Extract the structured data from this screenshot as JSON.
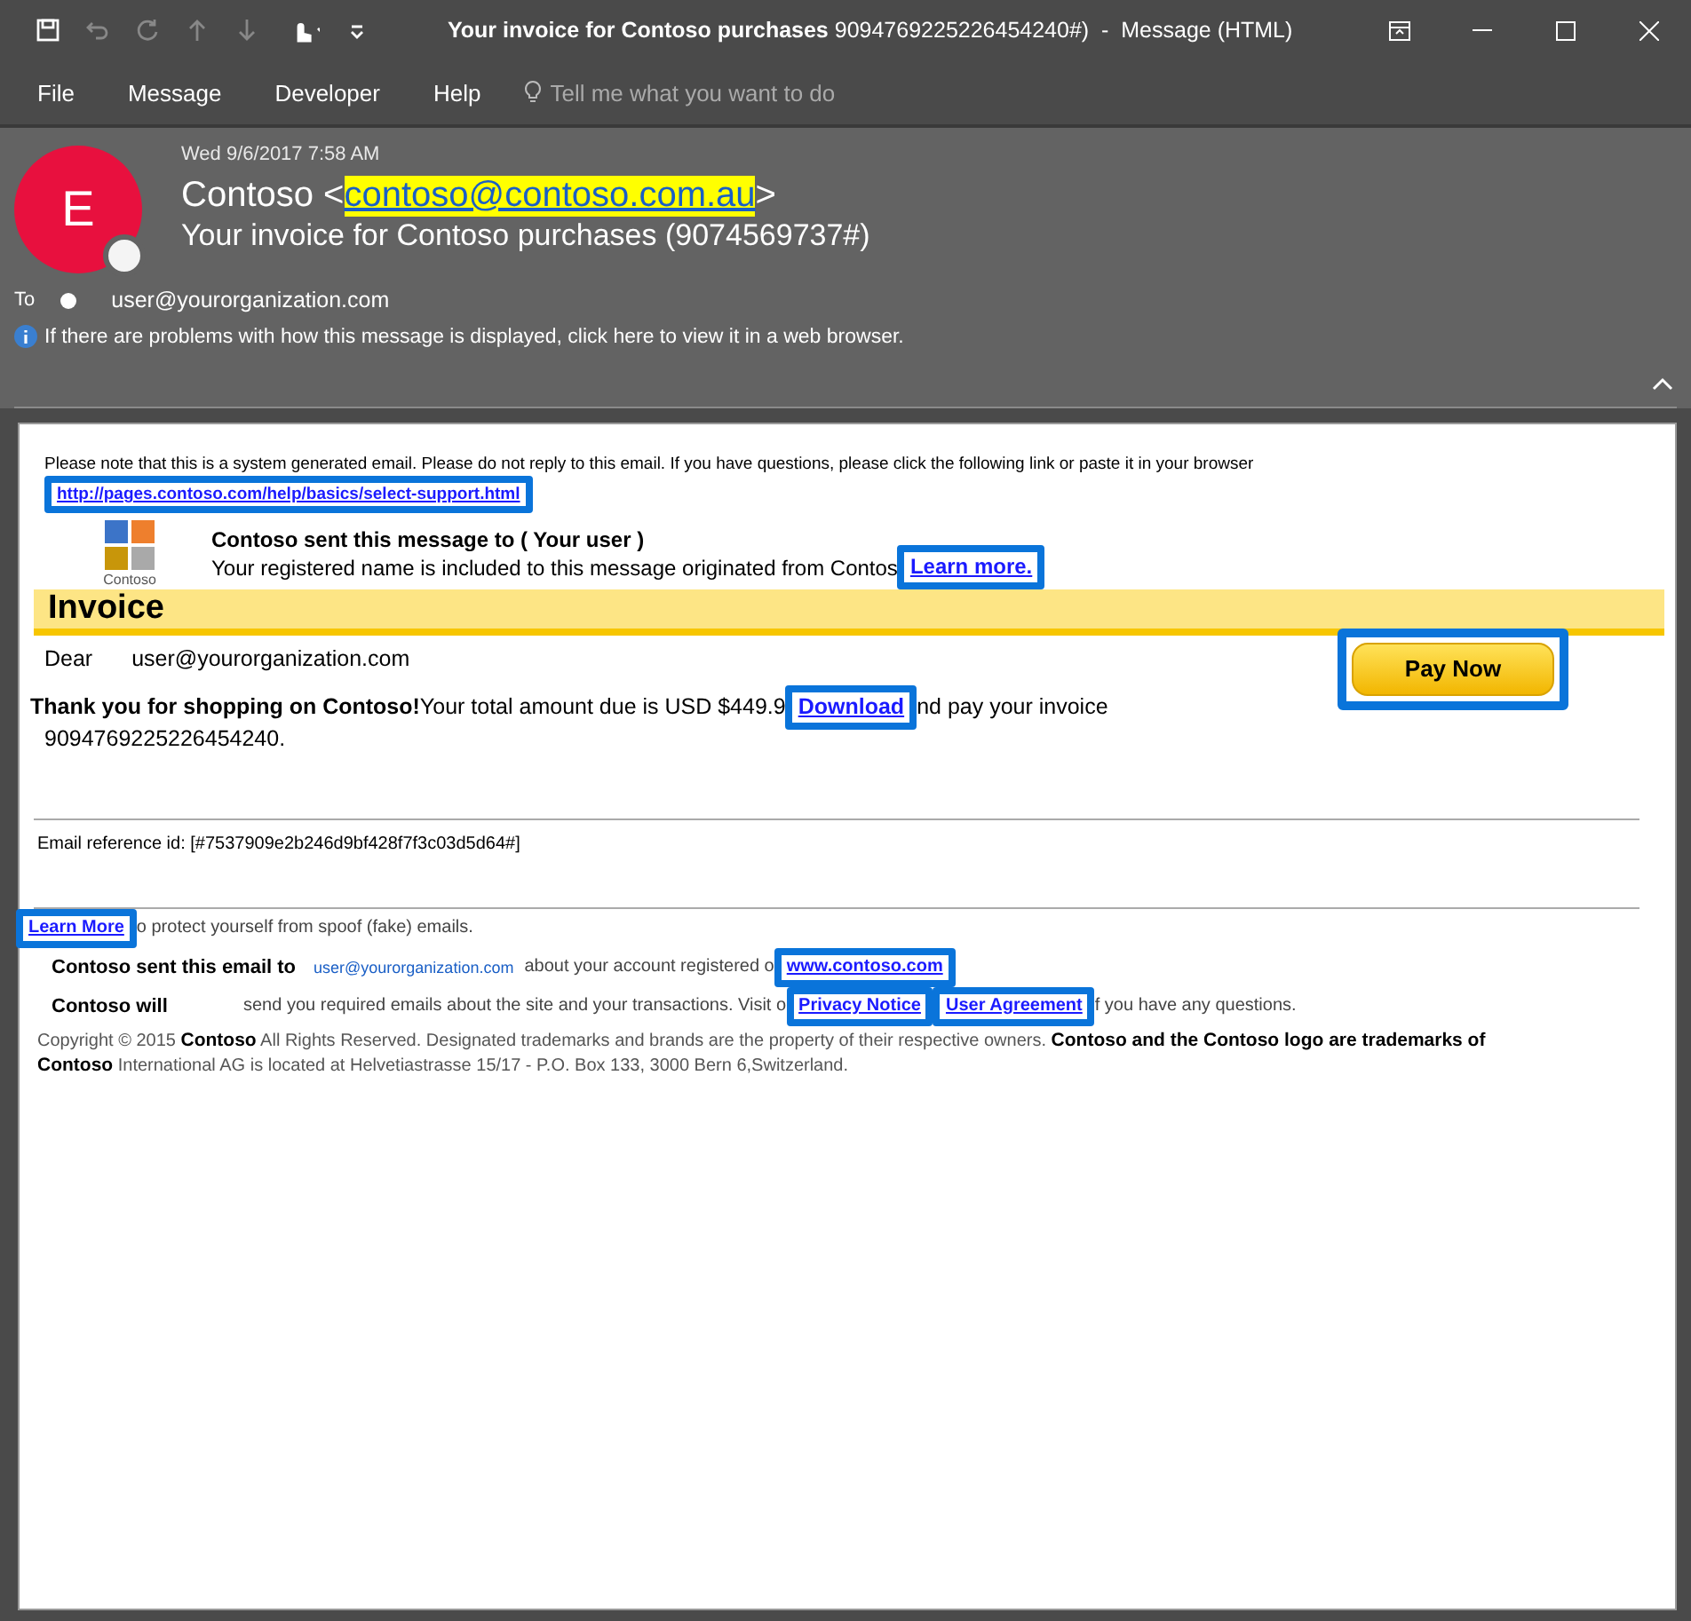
{
  "title_bar": {
    "title_bold": "Your invoice for Contoso purchases",
    "title_rest": "9094769225226454240#)  -  Message (HTML)"
  },
  "menu": [
    {
      "label": "File"
    },
    {
      "label": "Message"
    },
    {
      "label": "Developer"
    },
    {
      "label": "Help"
    }
  ],
  "tell_me": {
    "placeholder": "Tell me what you want to do"
  },
  "header": {
    "avatar_letter": "E",
    "date": "Wed 9/6/2017 7:58 AM",
    "sender_name": "Contoso <",
    "sender_email": "contoso@contoso.com.au",
    "sender_close": ">",
    "subject": "Your invoice for Contoso purchases (9074569737#)",
    "to_label": "To",
    "recipient": "user@yourorganization.com",
    "info": "If there are problems with how this message is displayed, click here to view it in a web browser."
  },
  "body": {
    "notice": {
      "text": "Please note that this is a system generated email. Please do not reply to this email. If you have questions, please click the following link or paste it in your browser",
      "link": "http://pages.contoso.com/help/basics/select-support.html",
      "highlighted": true
    },
    "logo_label": "Contoso",
    "sent_title": "Contoso sent this message to ( Your user )",
    "sent_text": "Your registered name is included to this message originated from Contos",
    "sent_link": {
      "label": "Learn more.",
      "highlighted": true
    },
    "banner": "Invoice",
    "dear_label": "Dear",
    "dear_name": "user@yourorganization.com",
    "pay_button": {
      "label": "Pay Now",
      "highlighted": true
    },
    "message_before": "**Thank you for shopping on Contoso!**Your total amount due is USD $449.9",
    "message_link": {
      "label": "Download",
      "highlighted": true
    },
    "message_after": "nd pay your invoice",
    "invoice_number": "9094769225226454240.",
    "reference": "Email reference id: [#7537909e2b246d9bf428f7f3c03d5d64#]",
    "spoof_link": {
      "label": "Learn More",
      "highlighted": true
    },
    "spoof_text": "o protect yourself from spoof (fake) emails.",
    "sent_email_label": "Contoso sent this email to",
    "sent_email_address": "user@yourorganization.com",
    "sent_email_text": "about your account registered o",
    "site_link": {
      "label": "www.contoso.com",
      "highlighted": true
    },
    "will_label": "Contoso will",
    "will_text": "send you required emails about the site and your transactions. Visit o",
    "privacy_link": {
      "label": "Privacy Notice",
      "highlighted": true
    },
    "agreement_link": {
      "label": "User Agreement",
      "highlighted": true
    },
    "will_after": "f you have any questions.",
    "copyright_1": "Copyright © 2015  **Contoso**  All Rights Reserved. Designated trademarks and brands are the property of their respective owners.  **Contoso and the Contoso logo are trademarks of**",
    "copyright_2": "**Contoso**  International AG is located at Helvetiastrasse 15/17 - P.O. Box 133, 3000 Bern 6,Switzerland."
  }
}
